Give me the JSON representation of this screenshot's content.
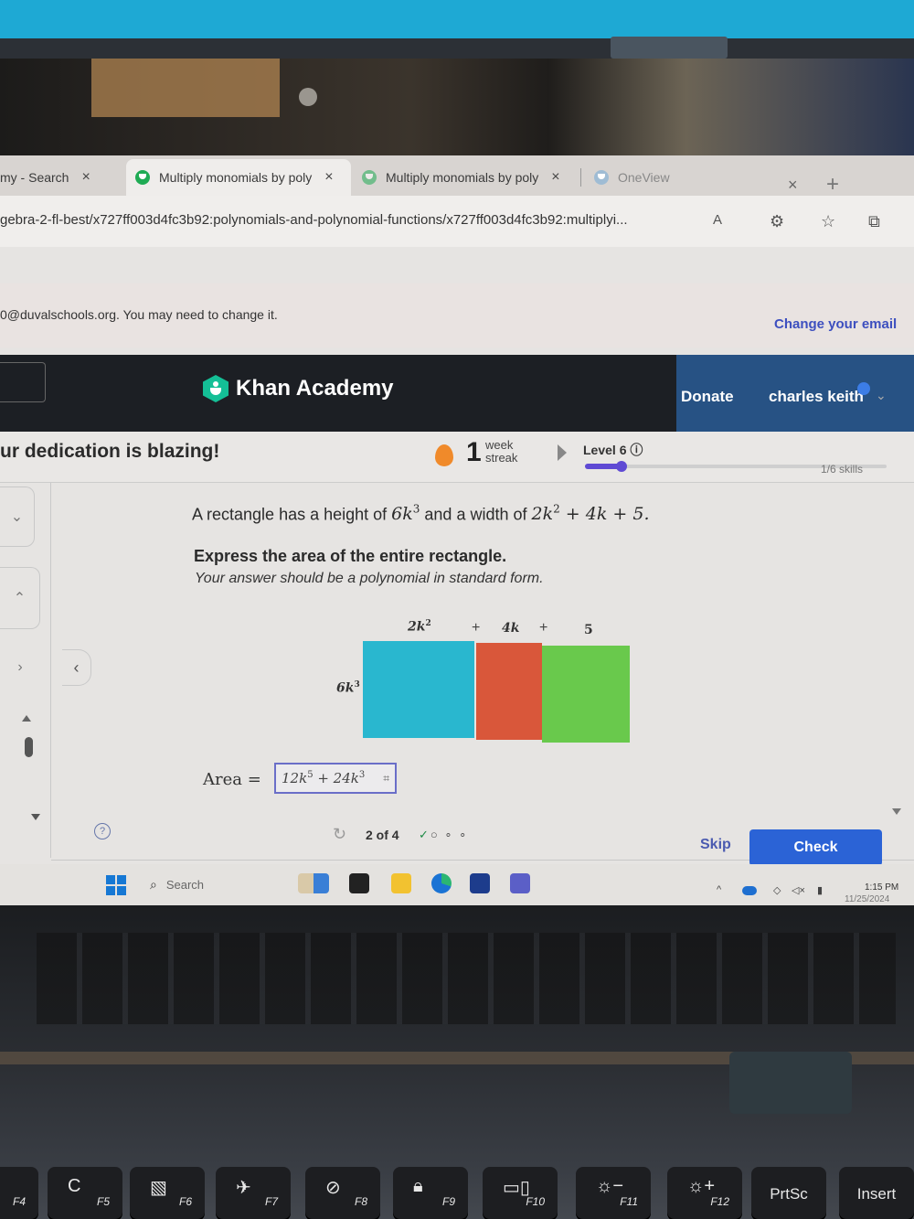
{
  "browser": {
    "tabs": [
      {
        "label": "my - Search",
        "active": false
      },
      {
        "label": "Multiply monomials by poly",
        "active": true
      },
      {
        "label": "Multiply monomials by poly",
        "active": false
      },
      {
        "label": "OneView",
        "active": false
      }
    ],
    "tab_close": "×",
    "window_close": "×",
    "new_tab": "+",
    "url": "gebra-2-fl-best/x727ff003d4fc3b92:polynomials-and-polynomial-functions/x727ff003d4fc3b92:multiplyi...",
    "icons": {
      "read_aloud": "A",
      "extensions": "⚙",
      "favorites": "☆",
      "collections": "⧉"
    }
  },
  "notice": {
    "text": "0@duvalschools.org. You may need to change it.",
    "link": "Change your email"
  },
  "header": {
    "brand": "Khan Academy",
    "donate": "Donate",
    "user": "charles keith",
    "user_caret": "⌄"
  },
  "progress": {
    "dedication": "ur dedication is blazing!",
    "streak_count": "1",
    "streak_label_1": "week",
    "streak_label_2": "streak",
    "level": "Level 6 ⓘ",
    "level_progress_fraction": 0.12,
    "skills": "1/6 skills"
  },
  "side": {
    "btn_down": "⌄",
    "btn_up": "⌃",
    "btn_next": "›",
    "back": "‹"
  },
  "question": {
    "line1_prefix": "A rectangle has a height of ",
    "height_coef": "6k",
    "height_exp": "3",
    "line1_mid": " and a width of ",
    "width_t1": "2k",
    "width_t1_exp": "2",
    "width_rest": " + 4k + 5.",
    "line2": "Express the area of the entire rectangle.",
    "line3": "Your answer should be a polynomial in standard form."
  },
  "diagram": {
    "top_labels": [
      {
        "base": "2k",
        "exp": "2"
      },
      {
        "base": "4k",
        "exp": ""
      },
      {
        "base": "5",
        "exp": ""
      }
    ],
    "plus": "+",
    "side_label": {
      "base": "6k",
      "exp": "3"
    },
    "colors": {
      "first": "#29b7cf",
      "second": "#d9573a",
      "third": "#69c94c"
    }
  },
  "answer": {
    "label": "Area =",
    "t1": "12k",
    "t1_exp": "5",
    "op": " + ",
    "t2": "24k",
    "t2_exp": "3",
    "keypad_icon": "⌗"
  },
  "footer": {
    "refresh_icon": "↻",
    "counter": "2 of 4",
    "dots_done": "✓",
    "dots_rest": "○ ∘ ∘",
    "skip": "Skip",
    "check": "Check",
    "hint_icon": "?"
  },
  "taskbar": {
    "search_icon": "⌕",
    "search": "Search",
    "time": "1:15 PM",
    "date": "11/25/2024",
    "tray_chevron": "^"
  },
  "keyboard": {
    "keys": [
      {
        "glyph": "",
        "fn": "F4"
      },
      {
        "glyph": "C",
        "fn": "F5"
      },
      {
        "glyph": "▧",
        "fn": "F6"
      },
      {
        "glyph": "✈",
        "fn": "F7"
      },
      {
        "glyph": "⊘",
        "fn": "F8"
      },
      {
        "glyph": "🔒︎",
        "fn": "F9"
      },
      {
        "glyph": "▭▯",
        "fn": "F10"
      },
      {
        "glyph": "☼−",
        "fn": "F11"
      },
      {
        "glyph": "☼+",
        "fn": "F12"
      },
      {
        "word": "PrtSc"
      },
      {
        "word": "Insert"
      }
    ]
  },
  "colors": {
    "accent": "#2b63d6",
    "level": "#5f4ad4",
    "khan_green": "#14bf96",
    "case": "#1ea9d4"
  }
}
